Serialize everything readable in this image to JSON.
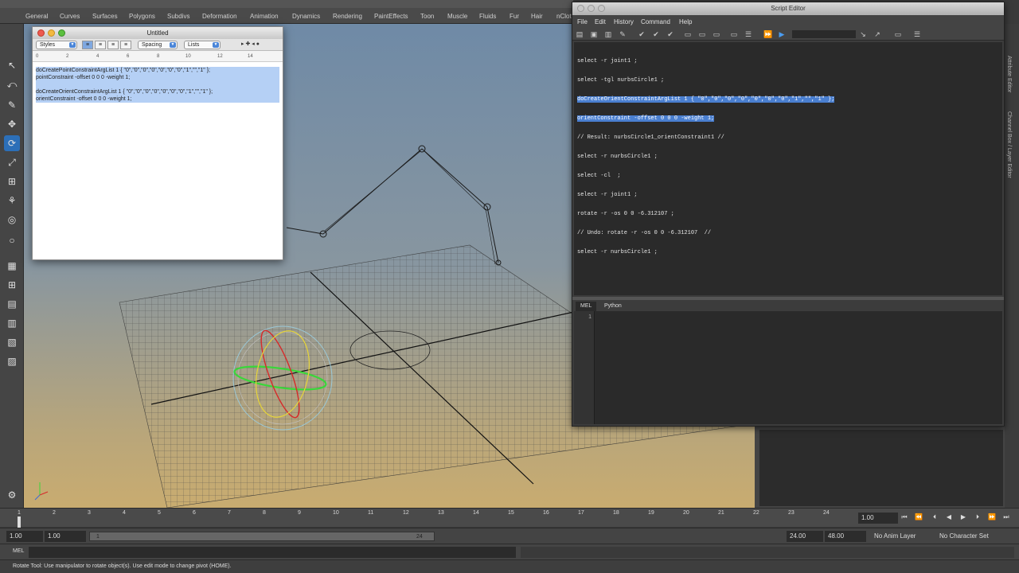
{
  "menus": {
    "shelf_tabs": [
      "General",
      "Curves",
      "Surfaces",
      "Polygons",
      "Subdivs",
      "Deformation",
      "Animation",
      "Dynamics",
      "Rendering",
      "PaintEffects",
      "Toon",
      "Muscle",
      "Fluids",
      "Fur",
      "Hair",
      "nCloth"
    ]
  },
  "text_window": {
    "title": "Untitled",
    "styles_label": "Styles",
    "spacing_label": "Spacing",
    "lists_label": "Lists",
    "ruler_marks": [
      "0",
      "2",
      "4",
      "6",
      "8",
      "10",
      "12",
      "14"
    ],
    "lines": [
      "doCreatePointConstraintArgList 1 { \"0\",\"0\",\"0\",\"0\",\"0\",\"0\",\"0\",\"1\",\"\",\"1\" };",
      "pointConstraint -offset 0 0 0 -weight 1;",
      "",
      "doCreateOrientConstraintArgList 1 { \"0\",\"0\",\"0\",\"0\",\"0\",\"0\",\"0\",\"1\",\"\",\"1\" };",
      "orientConstraint -offset 0 0 0 -weight 1;"
    ]
  },
  "script_editor": {
    "title": "Script Editor",
    "menu": [
      "File",
      "Edit",
      "History",
      "Command",
      "Help"
    ],
    "history": [
      {
        "text": "select -r joint1 ;",
        "hl": false
      },
      {
        "text": "select -tgl nurbsCircle1 ;",
        "hl": false
      },
      {
        "text": "doCreateOrientConstraintArgList 1 { \"0\",\"0\",\"0\",\"0\",\"0\",\"0\",\"0\",\"1\",\"\",\"1\" };",
        "hl": true
      },
      {
        "text": "orientConstraint -offset 0 0 0 -weight 1;",
        "hl": true
      },
      {
        "text": "// Result: nurbsCircle1_orientConstraint1 //",
        "hl": false
      },
      {
        "text": "select -r nurbsCircle1 ;",
        "hl": false
      },
      {
        "text": "select -cl  ;",
        "hl": false
      },
      {
        "text": "select -r joint1 ;",
        "hl": false
      },
      {
        "text": "rotate -r -os 0 0 -6.312107 ;",
        "hl": false
      },
      {
        "text": "// Undo: rotate -r -os 0 0 -6.312107  //",
        "hl": false
      },
      {
        "text": "select -r nurbsCircle1 ;",
        "hl": false
      }
    ],
    "tabs": [
      "MEL",
      "Python"
    ],
    "line_number": "1"
  },
  "side_tabs": [
    "Attribute Editor",
    "Channel Box / Layer Editor"
  ],
  "timeline": {
    "ticks": [
      "1",
      "2",
      "3",
      "4",
      "5",
      "6",
      "7",
      "8",
      "9",
      "10",
      "11",
      "12",
      "13",
      "14",
      "15",
      "16",
      "17",
      "18",
      "19",
      "20",
      "21",
      "22",
      "23",
      "24"
    ],
    "current_time": "1.00"
  },
  "range": {
    "start": "1.00",
    "playback_start": "1.00",
    "bar_start": "1",
    "bar_end": "24",
    "playback_end": "24.00",
    "end": "48.00",
    "anim_layer": "No Anim Layer",
    "character_set": "No Character Set"
  },
  "cmdline": {
    "label": "MEL"
  },
  "helpline": {
    "text": "Rotate Tool: Use manipulator to rotate object(s). Use edit mode to change pivot (HOME)."
  }
}
